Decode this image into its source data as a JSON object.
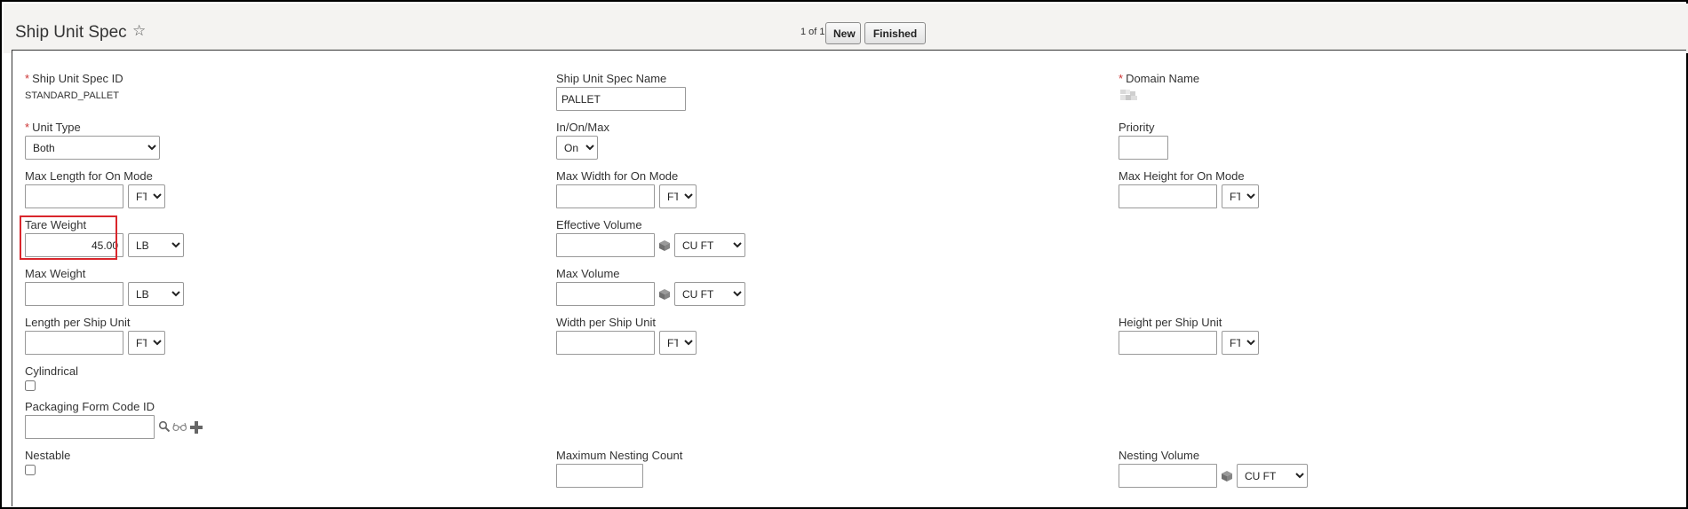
{
  "header": {
    "title": "Ship Unit Spec",
    "pager": "1 of 1",
    "new_label": "New",
    "finished_label": "Finished"
  },
  "fields": {
    "ship_unit_spec_id": {
      "label": "Ship Unit Spec ID",
      "value": "STANDARD_PALLET"
    },
    "ship_unit_spec_name": {
      "label": "Ship Unit Spec Name",
      "value": "PALLET"
    },
    "domain_name": {
      "label": "Domain Name"
    },
    "unit_type": {
      "label": "Unit Type",
      "value": "Both"
    },
    "in_on_max": {
      "label": "In/On/Max",
      "value": "On"
    },
    "priority": {
      "label": "Priority",
      "value": ""
    },
    "max_length_on": {
      "label": "Max Length for On Mode",
      "value": "",
      "uom": "FT"
    },
    "max_width_on": {
      "label": "Max Width for On Mode",
      "value": "",
      "uom": "FT"
    },
    "max_height_on": {
      "label": "Max Height for On Mode",
      "value": "",
      "uom": "FT"
    },
    "tare_weight": {
      "label": "Tare Weight",
      "value": "45.00",
      "uom": "LB"
    },
    "effective_volume": {
      "label": "Effective Volume",
      "value": "",
      "uom": "CU FT"
    },
    "max_weight": {
      "label": "Max Weight",
      "value": "",
      "uom": "LB"
    },
    "max_volume": {
      "label": "Max Volume",
      "value": "",
      "uom": "CU FT"
    },
    "length_per_su": {
      "label": "Length per Ship Unit",
      "value": "",
      "uom": "FT"
    },
    "width_per_su": {
      "label": "Width per Ship Unit",
      "value": "",
      "uom": "FT"
    },
    "height_per_su": {
      "label": "Height per Ship Unit",
      "value": "",
      "uom": "FT"
    },
    "cylindrical": {
      "label": "Cylindrical",
      "checked": false
    },
    "packaging_form_code": {
      "label": "Packaging Form Code ID",
      "value": ""
    },
    "nestable": {
      "label": "Nestable",
      "checked": false
    },
    "max_nesting_count": {
      "label": "Maximum Nesting Count",
      "value": ""
    },
    "nesting_volume": {
      "label": "Nesting Volume",
      "value": "",
      "uom": "CU FT"
    }
  },
  "colors": {
    "header_bg": "#f4f3f1",
    "required": "#cc3333",
    "highlight": "#d9262c"
  },
  "icons": [
    "star-icon",
    "cube-icon",
    "search-icon",
    "glasses-icon",
    "plus-icon"
  ]
}
